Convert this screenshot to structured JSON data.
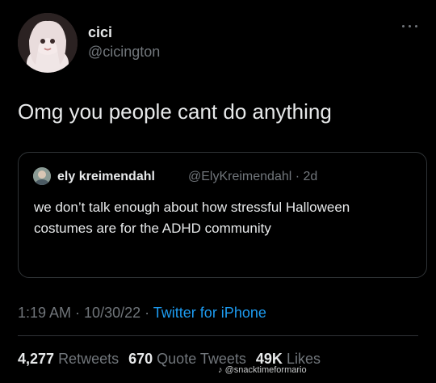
{
  "tweet": {
    "author": {
      "name": "cici",
      "handle": "@cicington",
      "avatar_icon": "profile-photo"
    },
    "text": "Omg you people cant do anything",
    "quote": {
      "author_name": "ely kreimendahl",
      "author_handle": "@ElyKreimendahl",
      "age": "2d",
      "text": "we don’t talk enough about how stressful Halloween costumes are for the ADHD community"
    },
    "time": "1:19 AM",
    "date": "10/30/22",
    "source": "Twitter for iPhone",
    "stats": {
      "retweets": "4,277",
      "retweets_label": "Retweets",
      "quotes": "670",
      "quotes_label": "Quote Tweets",
      "likes": "49K",
      "likes_label": "Likes"
    }
  },
  "watermark": "@snacktimeformario",
  "colors": {
    "background": "#000000",
    "text": "#e7e9ea",
    "muted": "#71767b",
    "link": "#1d9bf0",
    "border": "#2f3336"
  }
}
